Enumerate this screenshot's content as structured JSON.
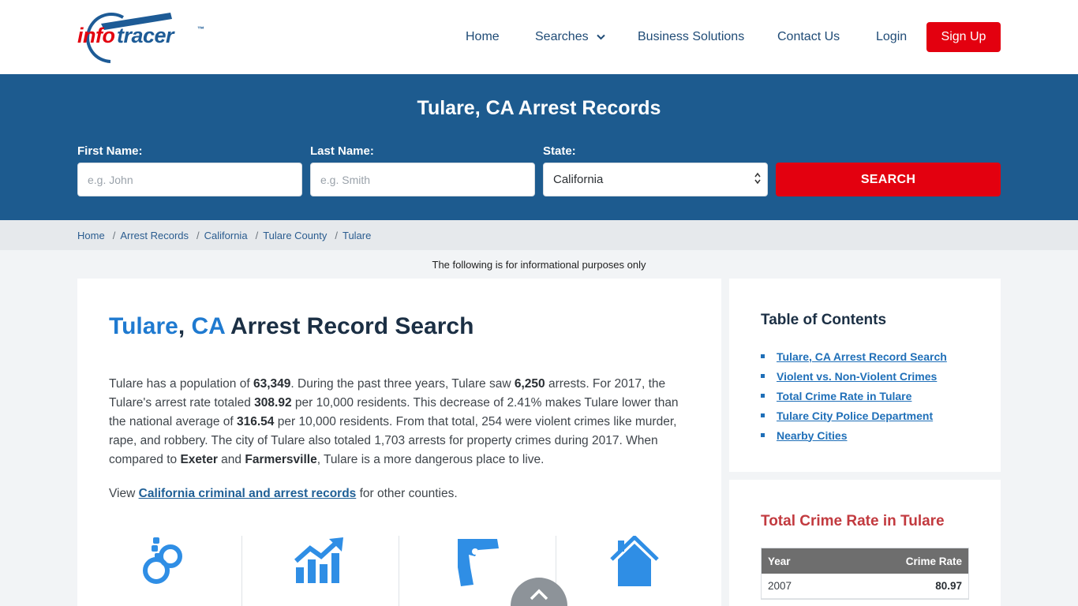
{
  "header": {
    "logo_part1": "info",
    "logo_part2": "tracer",
    "logo_tm": "™",
    "nav": [
      {
        "label": "Home"
      },
      {
        "label": "Searches"
      },
      {
        "label": "Business Solutions"
      },
      {
        "label": "Contact Us"
      },
      {
        "label": "Login"
      }
    ],
    "signup_label": "Sign Up"
  },
  "hero": {
    "title": "Tulare, CA Arrest Records",
    "first_name_label": "First Name:",
    "first_name_placeholder": "e.g. John",
    "last_name_label": "Last Name:",
    "last_name_placeholder": "e.g. Smith",
    "state_label": "State:",
    "state_value": "California",
    "search_label": "SEARCH"
  },
  "breadcrumb": [
    "Home",
    "Arrest Records",
    "California",
    "Tulare County",
    "Tulare"
  ],
  "breadcrumb_sep": "/",
  "info_note": "The following is for informational purposes only",
  "main": {
    "title_city": "Tulare",
    "title_comma": ",",
    "title_state": "CA",
    "title_rest": "Arrest Record Search",
    "para": {
      "t1": "Tulare has a population of ",
      "b1": "63,349",
      "t2": ". During the past three years, Tulare saw ",
      "b2": "6,250",
      "t3": " arrests. For 2017, the Tulare's arrest rate totaled ",
      "b3": "308.92",
      "t4": " per 10,000 residents. This decrease of 2.41% makes Tulare lower than the national average of ",
      "b4": "316.54",
      "t5": " per 10,000 residents. From that total, 254 were violent crimes like murder, rape, and robbery. The city of Tulare also totaled 1,703 arrests for property crimes during 2017. When compared to ",
      "b5": "Exeter",
      "t6": " and ",
      "b6": "Farmersville",
      "t7": ", Tulare is a more dangerous place to live."
    },
    "view_prefix": "View ",
    "view_link": "California criminal and arrest records",
    "view_suffix": " for other counties.",
    "icons": [
      "handcuffs-icon",
      "chart-up-icon",
      "gun-icon",
      "house-icon"
    ]
  },
  "toc": {
    "title": "Table of Contents",
    "items": [
      "Tulare, CA Arrest Record Search",
      "Violent vs. Non-Violent Crimes",
      "Total Crime Rate in Tulare",
      "Tulare City Police Department",
      "Nearby Cities"
    ]
  },
  "crime_rate": {
    "title": "Total Crime Rate in Tulare",
    "col_year": "Year",
    "col_rate": "Crime Rate",
    "rows": [
      {
        "year": "2007",
        "rate": "80.97"
      }
    ]
  },
  "colors": {
    "brand_red": "#e3000f",
    "brand_blue": "#1d5b8f",
    "accent_blue": "#1f7ad0",
    "icon_blue": "#2f8ee5"
  }
}
